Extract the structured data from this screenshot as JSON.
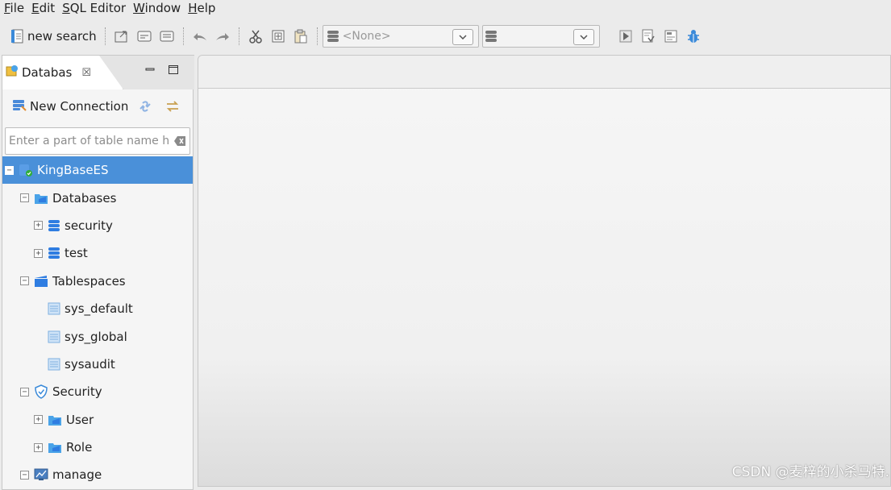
{
  "menu": {
    "items": [
      {
        "mnemonic": "F",
        "rest": "ile"
      },
      {
        "mnemonic": "E",
        "rest": "dit"
      },
      {
        "mnemonic": "S",
        "rest": "QL Editor"
      },
      {
        "mnemonic": "W",
        "rest": "indow"
      },
      {
        "mnemonic": "H",
        "rest": "elp"
      }
    ]
  },
  "toolbar": {
    "new_search_label": "new search",
    "datasource_combo_value": "<None>",
    "database_combo_value": ""
  },
  "panel": {
    "tab_label": "Databas",
    "tab_close": "☒",
    "new_connection_label": "New Connection",
    "filter_placeholder": "Enter a part of table name h"
  },
  "tree": {
    "connection": "KingBaseES",
    "databases": "Databases",
    "db_security": "security",
    "db_test": "test",
    "tablespaces": "Tablespaces",
    "ts_default": "sys_default",
    "ts_global": "sys_global",
    "ts_audit": "sysaudit",
    "security": "Security",
    "user": "User",
    "role": "Role",
    "manage": "manage"
  },
  "watermark": "CSDN @麦梓的小杀马特.",
  "colors": {
    "selection": "#4a90d9",
    "db_icon_blue": "#2f7de1",
    "folder_blue": "#4aa3e8"
  }
}
